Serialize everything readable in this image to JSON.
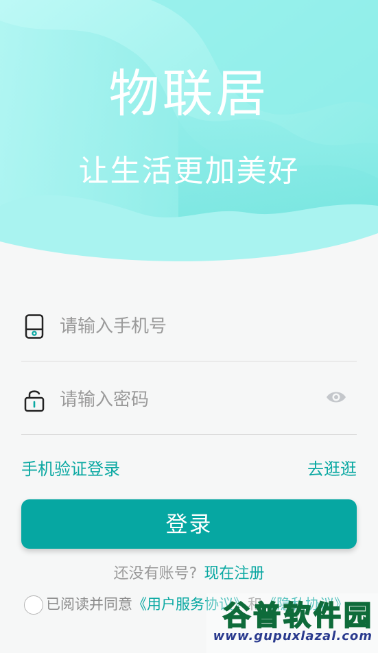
{
  "hero": {
    "app_title": "物联居",
    "slogan": "让生活更加美好"
  },
  "form": {
    "phone_placeholder": "请输入手机号",
    "password_placeholder": "请输入密码",
    "phone_icon": "phone-icon",
    "lock_icon": "lock-icon",
    "eye_icon": "eye-icon"
  },
  "links": {
    "sms_login": "手机验证登录",
    "browse": "去逛逛"
  },
  "login_button": "登录",
  "register": {
    "question": "还没有账号?",
    "action": "现在注册"
  },
  "agreement": {
    "prefix": "已阅读并同意",
    "user_agreement": "《用户服务协议》",
    "and": "和",
    "privacy_policy": "《隐私协议》"
  },
  "watermark": {
    "name": "谷普软件园",
    "url": "www.gupuxlazal.com"
  },
  "colors": {
    "accent": "#06a7a2",
    "hero_light": "#bff8f6",
    "hero_mid": "#7ee9e4",
    "background": "#f6f7f7"
  }
}
